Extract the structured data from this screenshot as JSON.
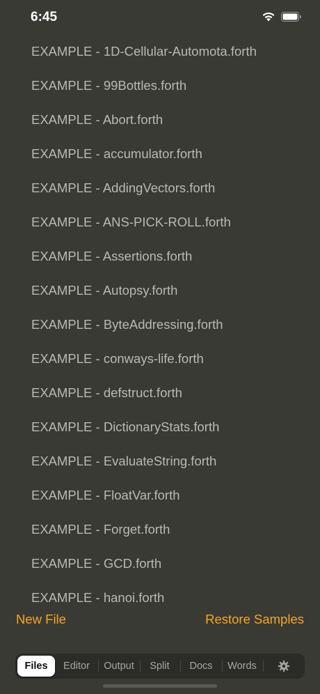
{
  "status_bar": {
    "time": "6:45",
    "wifi_icon": "wifi-icon",
    "battery_icon": "battery-icon"
  },
  "files": [
    "EXAMPLE - 1D-Cellular-Automota.forth",
    "EXAMPLE - 99Bottles.forth",
    "EXAMPLE - Abort.forth",
    "EXAMPLE - accumulator.forth",
    "EXAMPLE - AddingVectors.forth",
    "EXAMPLE - ANS-PICK-ROLL.forth",
    "EXAMPLE - Assertions.forth",
    "EXAMPLE - Autopsy.forth",
    "EXAMPLE - ByteAddressing.forth",
    "EXAMPLE - conways-life.forth",
    "EXAMPLE - defstruct.forth",
    "EXAMPLE - DictionaryStats.forth",
    "EXAMPLE - EvaluateString.forth",
    "EXAMPLE - FloatVar.forth",
    "EXAMPLE - Forget.forth",
    "EXAMPLE - GCD.forth",
    "EXAMPLE - hanoi.forth"
  ],
  "actions": {
    "new_file": "New File",
    "restore_samples": "Restore Samples"
  },
  "tabs": {
    "files": "Files",
    "editor": "Editor",
    "output": "Output",
    "split": "Split",
    "docs": "Docs",
    "words": "Words",
    "settings_icon": "gear-icon",
    "selected": "Files"
  },
  "colors": {
    "background": "#3a3a35",
    "accent": "#f5a623",
    "text": "#b9b9b4"
  }
}
